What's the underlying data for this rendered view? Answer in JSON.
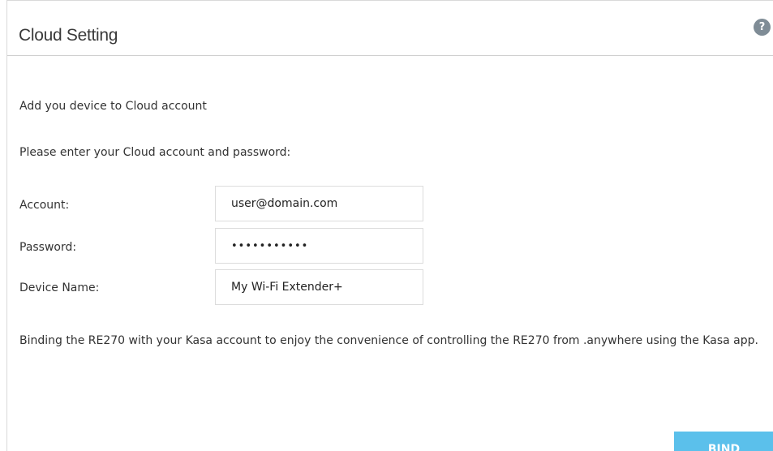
{
  "header": {
    "title": "Cloud Setting",
    "help_icon": "question-mark-icon",
    "help_glyph": "?"
  },
  "intro_text": "Add you device to Cloud account",
  "prompt_text": "Please enter your Cloud account and password:",
  "form": {
    "account": {
      "label": "Account:",
      "value": "user@domain.com"
    },
    "password": {
      "label": "Password:",
      "value": "•••••••••••"
    },
    "device_name": {
      "label": "Device Name:",
      "value": "My Wi-Fi Extender+"
    }
  },
  "description": "Binding the RE270 with your Kasa account to enjoy the convenience of controlling the RE270 from .anywhere using the Kasa app.",
  "bind_button": {
    "label": "BIND",
    "color": "#5bc0eb"
  }
}
